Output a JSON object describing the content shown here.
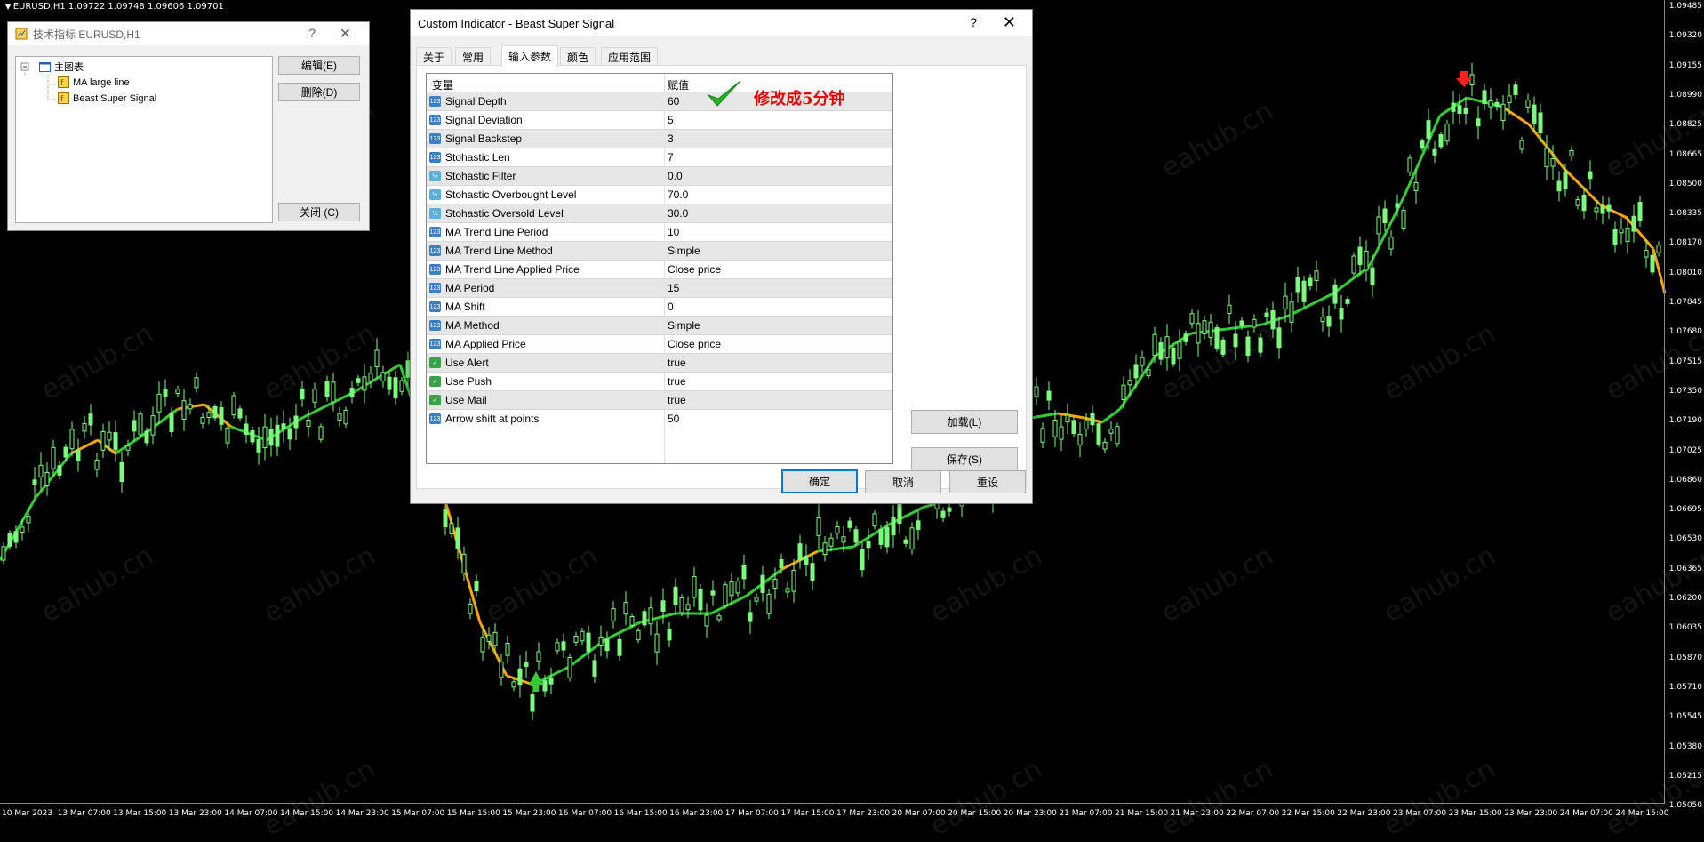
{
  "chart": {
    "symbol_info": "EURUSD,H1  1.09722 1.09748 1.09606 1.09701",
    "price_labels": [
      "1.09485",
      "1.09320",
      "1.09155",
      "1.08990",
      "1.08825",
      "1.08665",
      "1.08500",
      "1.08335",
      "1.08170",
      "1.08010",
      "1.07845",
      "1.07680",
      "1.07515",
      "1.07350",
      "1.07190",
      "1.07025",
      "1.06860",
      "1.06695",
      "1.06530",
      "1.06365",
      "1.06200",
      "1.06035",
      "1.05870",
      "1.05710",
      "1.05545",
      "1.05380",
      "1.05215",
      "1.05050"
    ],
    "time_labels": [
      "10 Mar 2023",
      "13 Mar 07:00",
      "13 Mar 15:00",
      "13 Mar 23:00",
      "14 Mar 07:00",
      "14 Mar 15:00",
      "14 Mar 23:00",
      "15 Mar 07:00",
      "15 Mar 15:00",
      "15 Mar 23:00",
      "16 Mar 07:00",
      "16 Mar 15:00",
      "16 Mar 23:00",
      "17 Mar 07:00",
      "17 Mar 15:00",
      "17 Mar 23:00",
      "20 Mar 07:00",
      "20 Mar 15:00",
      "20 Mar 23:00",
      "21 Mar 07:00",
      "21 Mar 15:00",
      "21 Mar 23:00",
      "22 Mar 07:00",
      "22 Mar 15:00",
      "22 Mar 23:00",
      "23 Mar 07:00",
      "23 Mar 15:00",
      "23 Mar 23:00",
      "24 Mar 07:00",
      "24 Mar 15:00"
    ],
    "watermark": "eahub.cn",
    "colors": {
      "candle": "#7cfc7c",
      "ma_up": "#32cd32",
      "ma_down": "#ffa500",
      "arrow_up": "#32cd32",
      "arrow_down": "#ff2020"
    }
  },
  "indicators_window": {
    "title": "技术指标 EURUSD,H1",
    "help": "?",
    "close": "✕",
    "tree": {
      "root": "主图表",
      "items": [
        "MA large line",
        "Beast Super Signal"
      ]
    },
    "buttons": {
      "edit": "编辑(E)",
      "delete": "删除(D)",
      "close": "关闭 (C)"
    }
  },
  "dialog": {
    "title": "Custom Indicator - Beast Super Signal",
    "help": "?",
    "close": "✕",
    "tabs": [
      {
        "label": "关于",
        "active": false
      },
      {
        "label": "常用",
        "active": false
      },
      {
        "label": "输入参数",
        "active": true
      },
      {
        "label": "颜色",
        "active": false
      },
      {
        "label": "应用范围",
        "active": false
      }
    ],
    "columns": {
      "variable": "变量",
      "value": "赋值"
    },
    "params": [
      {
        "name": "Signal Depth",
        "value": "60",
        "type": "int"
      },
      {
        "name": "Signal Deviation",
        "value": "5",
        "type": "int"
      },
      {
        "name": "Signal Backstep",
        "value": "3",
        "type": "int"
      },
      {
        "name": "Stohastic Len",
        "value": "7",
        "type": "int"
      },
      {
        "name": "Stohastic Filter",
        "value": "0.0",
        "type": "dbl"
      },
      {
        "name": "Stohastic Overbought Level",
        "value": "70.0",
        "type": "dbl"
      },
      {
        "name": "Stohastic Oversold Level",
        "value": "30.0",
        "type": "dbl"
      },
      {
        "name": "MA Trend Line Period",
        "value": "10",
        "type": "int"
      },
      {
        "name": "MA Trend Line Method",
        "value": "Simple",
        "type": "int"
      },
      {
        "name": "MA Trend Line Applied Price",
        "value": "Close price",
        "type": "int"
      },
      {
        "name": "MA Period",
        "value": "15",
        "type": "int"
      },
      {
        "name": "MA Shift",
        "value": "0",
        "type": "int"
      },
      {
        "name": "MA Method",
        "value": "Simple",
        "type": "int"
      },
      {
        "name": "MA Applied Price",
        "value": "Close price",
        "type": "int"
      },
      {
        "name": "Use Alert",
        "value": "true",
        "type": "bool"
      },
      {
        "name": "Use Push",
        "value": "true",
        "type": "bool"
      },
      {
        "name": "Use Mail",
        "value": "true",
        "type": "bool"
      },
      {
        "name": "Arrow shift at points",
        "value": "50",
        "type": "int"
      }
    ],
    "annotation": "修改成5分钟",
    "buttons": {
      "load": "加载(L)",
      "save": "保存(S)",
      "ok": "确定",
      "cancel": "取消",
      "reset": "重设"
    }
  }
}
